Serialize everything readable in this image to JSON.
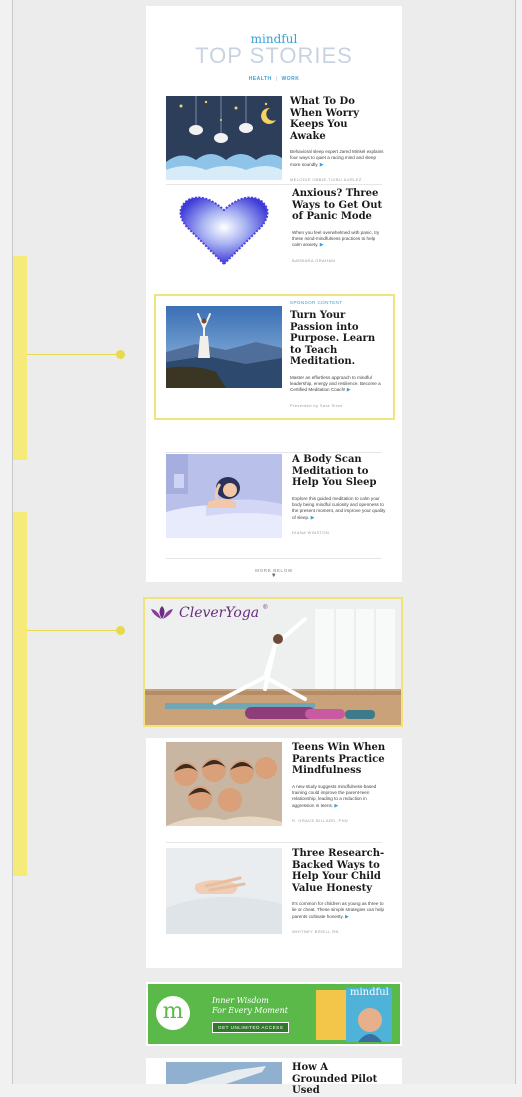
{
  "colors": {
    "accent": "#3aa0d6",
    "highlight": "#f6ea7a",
    "promo_green": "#5bb94a"
  },
  "header": {
    "brand": "mindful",
    "title": "TOP STORIES",
    "nav": [
      "HEALTH",
      "WORK"
    ]
  },
  "stories": [
    {
      "title": "What To Do When Worry Keeps You Awake",
      "body": "Behavioral sleep expert Jared Minkel explains four ways to quiet a racing mind and sleep more soundly.",
      "arrow": "▶",
      "byline": "MELODIE OBBIE-TUIBU AURLEZ"
    },
    {
      "title": "Anxious? Three Ways to Get Out of Panic Mode",
      "body": "When you feel overwhelmed with panic, try these mind-mindfulness practices to help calm anxiety.",
      "arrow": "▶",
      "byline": "BARBARA GRAHAM"
    },
    {
      "label": "SPONSOR CONTENT",
      "title": "Turn Your Passion into Purpose. Learn to Teach Meditation.",
      "body": "Master an effortless approach to mindful leadership, energy and resilience. Become a Certified Meditation Coach!",
      "arrow": "▶",
      "byline": "Presented by Sara Siren"
    },
    {
      "title": "A Body Scan Meditation to Help You Sleep",
      "body": "Explore this guided meditation to calm your body being mindful curiosity and openness to the present moment, and improve your quality of sleep.",
      "arrow": "▶",
      "byline": "DIANA WINSTON"
    },
    {
      "title": "Teens Win When Parents Practice Mindfulness",
      "body": "A new study suggests mindfulness-based training could improve the parent-teen relationship, leading to a reduction in aggression in teens.",
      "arrow": "▶",
      "byline": "R. GRACE BILLARD, PHD"
    },
    {
      "title": "Three Research-Backed Ways to Help Your Child Value Honesty",
      "body": "It's common for children as young as three to lie or cheat. These simple strategies can help parents cultivate honesty.",
      "arrow": "▶",
      "byline": "WHITNEY BRIELL RN"
    },
    {
      "title": "How A Grounded Pilot Used"
    }
  ],
  "more_below": {
    "label": "MORE BELOW",
    "icon": "▼"
  },
  "ad": {
    "brand": "CleverYoga",
    "trademark": "®"
  },
  "promo": {
    "letter": "m",
    "tagline_1": "Inner Wisdom",
    "tagline_2": "For Every Moment",
    "button": "GET UNLIMITED ACCESS",
    "magazine_brand": "mindful"
  }
}
